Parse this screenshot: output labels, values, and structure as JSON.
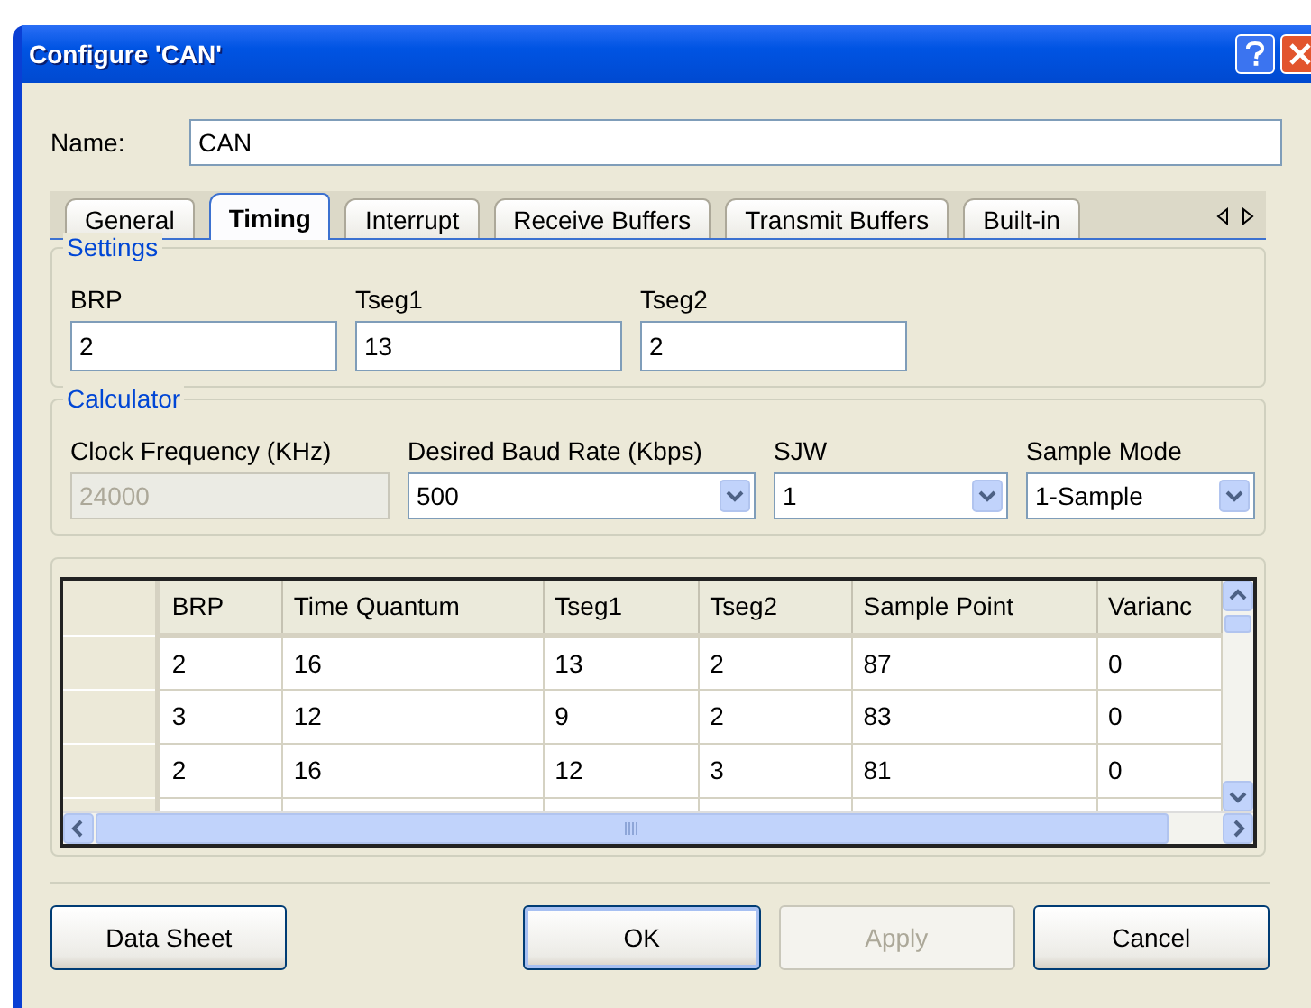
{
  "window": {
    "title": "Configure 'CAN'"
  },
  "name_field": {
    "label": "Name:",
    "value": "CAN"
  },
  "tabs": [
    {
      "label": "General",
      "selected": false
    },
    {
      "label": "Timing",
      "selected": true
    },
    {
      "label": "Interrupt",
      "selected": false
    },
    {
      "label": "Receive Buffers",
      "selected": false
    },
    {
      "label": "Transmit Buffers",
      "selected": false
    },
    {
      "label": "Built-in",
      "selected": false
    }
  ],
  "settings": {
    "title": "Settings",
    "fields": [
      {
        "label": "BRP",
        "value": "2"
      },
      {
        "label": "Tseg1",
        "value": "13"
      },
      {
        "label": "Tseg2",
        "value": "2"
      }
    ]
  },
  "calculator": {
    "title": "Calculator",
    "fields": [
      {
        "kind": "text",
        "label": "Clock Frequency (KHz)",
        "value": "24000",
        "disabled": true
      },
      {
        "kind": "dropdown",
        "label": "Desired Baud Rate (Kbps)",
        "value": "500",
        "disabled": false
      },
      {
        "kind": "dropdown",
        "label": "SJW",
        "value": "1",
        "disabled": false
      },
      {
        "kind": "dropdown",
        "label": "Sample Mode",
        "value": "1-Sample",
        "disabled": false
      }
    ]
  },
  "table": {
    "columns": [
      "BRP",
      "Time Quantum",
      "Tseg1",
      "Tseg2",
      "Sample Point",
      "Varianc"
    ],
    "rows": [
      [
        "2",
        "16",
        "13",
        "2",
        "87",
        "0"
      ],
      [
        "3",
        "12",
        "9",
        "2",
        "83",
        "0"
      ],
      [
        "2",
        "16",
        "12",
        "3",
        "81",
        "0"
      ]
    ]
  },
  "buttons": [
    {
      "label": "Data Sheet",
      "disabled": false,
      "default": false
    },
    {
      "label": "OK",
      "disabled": false,
      "default": true
    },
    {
      "label": "Apply",
      "disabled": true,
      "default": false
    },
    {
      "label": "Cancel",
      "disabled": false,
      "default": false
    }
  ]
}
